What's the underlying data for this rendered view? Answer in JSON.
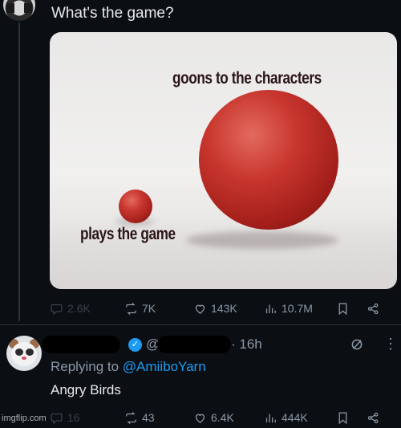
{
  "post": {
    "text": "What's the game?",
    "image": {
      "label_big": "goons to the characters",
      "label_small": "plays the game"
    },
    "stats": {
      "replies": "2.6K",
      "reposts": "7K",
      "likes": "143K",
      "views": "10.7M"
    }
  },
  "reply": {
    "handle_prefix": "@",
    "time": "· 16h",
    "replying_prefix": "Replying to",
    "replying_to": "@AmiiboYarn",
    "text": "Angry Birds",
    "stats": {
      "replies": "16",
      "reposts": "43",
      "likes": "6.4K",
      "views": "444K"
    }
  },
  "watermark": "imgflip.com",
  "colors": {
    "background": "#0b0f14",
    "accent": "#1d9bf0",
    "muted": "#8b98a5",
    "ball": "#c8362e"
  }
}
